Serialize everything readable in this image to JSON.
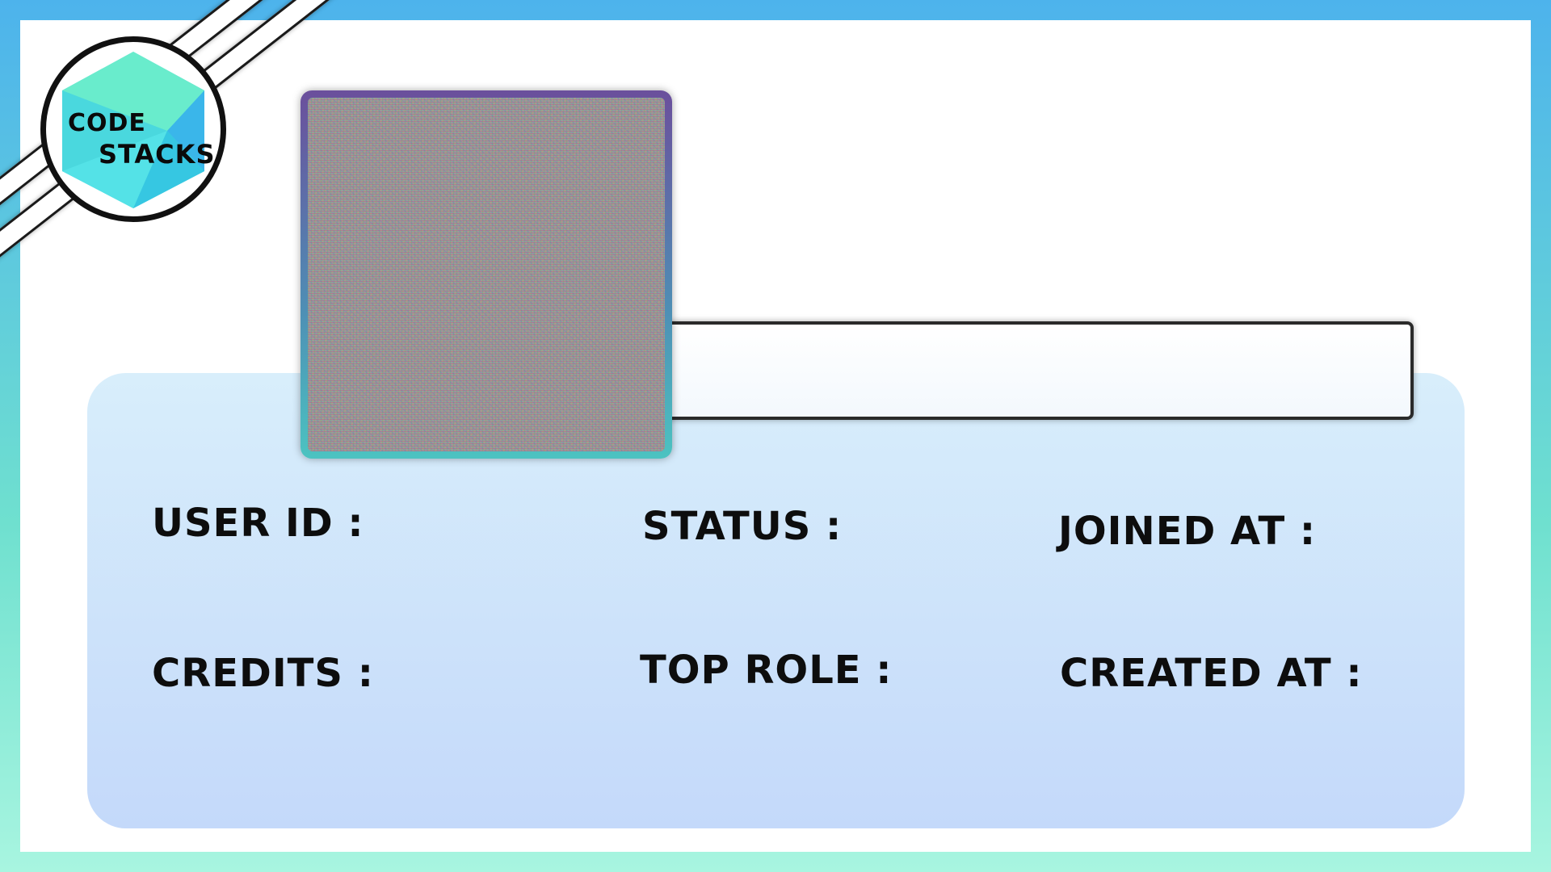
{
  "logo": {
    "line1": "CODE",
    "line2": "STACKS"
  },
  "fields": {
    "user_id": "USER ID :",
    "status": "STATUS :",
    "joined_at": "JOINED AT :",
    "credits": "CREDITS :",
    "top_role": "TOP ROLE :",
    "created_at": "CREATED AT :"
  },
  "colors": {
    "frame_top": "#4db3ec",
    "frame_bottom": "#a8f5e0",
    "panel_top": "#d8eefb",
    "panel_bottom": "#c4d9fa",
    "avatar_border_top": "#6b4f9c",
    "avatar_border_bottom": "#4cc3c1",
    "logo_hex_light": "#5de8d0",
    "logo_hex_dark": "#3cc6e6"
  }
}
